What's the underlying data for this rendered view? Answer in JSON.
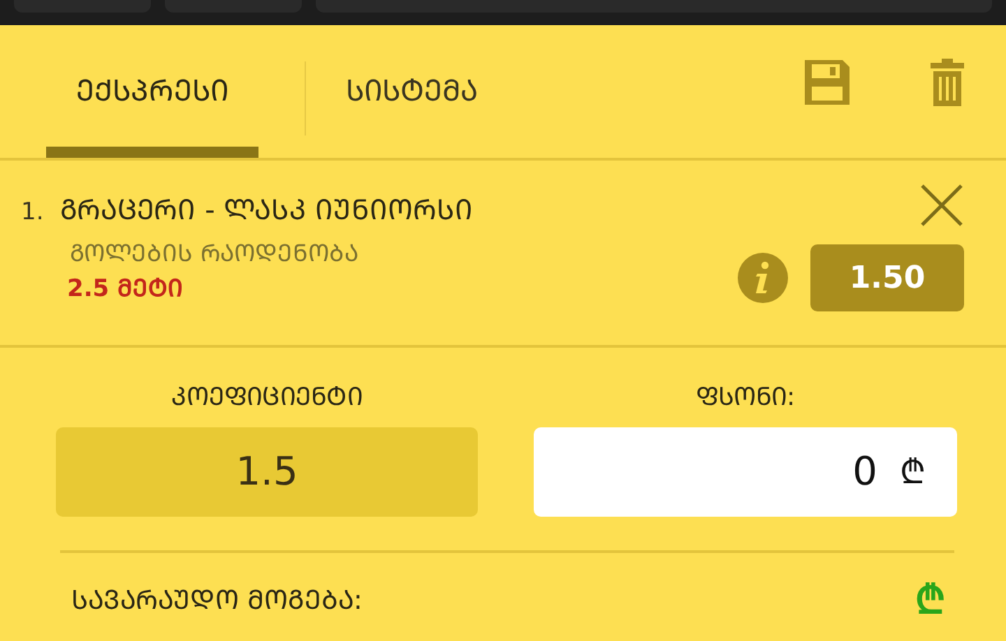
{
  "tabs": [
    {
      "label": "ᲔᲥᲡᲞᲠᲔᲡᲘ",
      "selected": true
    },
    {
      "label": "ᲡᲘᲡᲢᲔᲛᲐ",
      "selected": false
    }
  ],
  "bet": {
    "number": "1.",
    "match": "ᲒᲠᲐᲪᲔᲠᲘ - ᲚᲐᲡᲙ ᲘᲣᲜᲘᲝᲠᲡᲘ",
    "market": "ᲒᲝᲚᲔᲑᲘᲡ ᲠᲐᲝᲓᲔᲜᲝᲑᲐ",
    "selection": "2.5 ᲛᲔᲢᲘ",
    "odds": "1.50"
  },
  "coefficient": {
    "label": "ᲙᲝᲔᲤᲘᲪᲘᲔᲜᲢᲘ",
    "value": "1.5"
  },
  "stake": {
    "label": "ᲤᲡᲝᲜᲘ:",
    "value": "0",
    "currency": "₾"
  },
  "potential_win": {
    "label": "ᲡᲐᲕᲐᲠᲐᲣᲓᲝ ᲛᲝᲒᲔᲑᲐ:",
    "currency": "₾"
  }
}
